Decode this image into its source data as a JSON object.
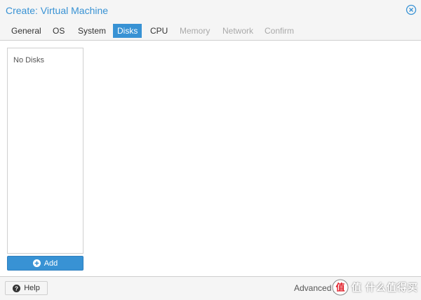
{
  "window": {
    "title": "Create: Virtual Machine"
  },
  "tabs": [
    {
      "label": "General",
      "state": "enabled"
    },
    {
      "label": "OS",
      "state": "enabled"
    },
    {
      "label": "System",
      "state": "enabled"
    },
    {
      "label": "Disks",
      "state": "active"
    },
    {
      "label": "CPU",
      "state": "enabled"
    },
    {
      "label": "Memory",
      "state": "disabled"
    },
    {
      "label": "Network",
      "state": "disabled"
    },
    {
      "label": "Confirm",
      "state": "disabled"
    }
  ],
  "disks": {
    "empty_text": "No Disks",
    "add_label": "Add"
  },
  "footer": {
    "help_label": "Help",
    "advanced_label": "Advanced"
  },
  "watermark": {
    "text": "值 什么值得买"
  },
  "icons": {
    "close": "close-circle-icon",
    "add": "plus-circle-icon",
    "help": "question-circle-icon",
    "watermark": "smzdm-logo-icon"
  },
  "colors": {
    "accent": "#3892d4",
    "disabled_text": "#a9a9a9",
    "background": "#f5f5f5",
    "border": "#cfcfcf"
  }
}
